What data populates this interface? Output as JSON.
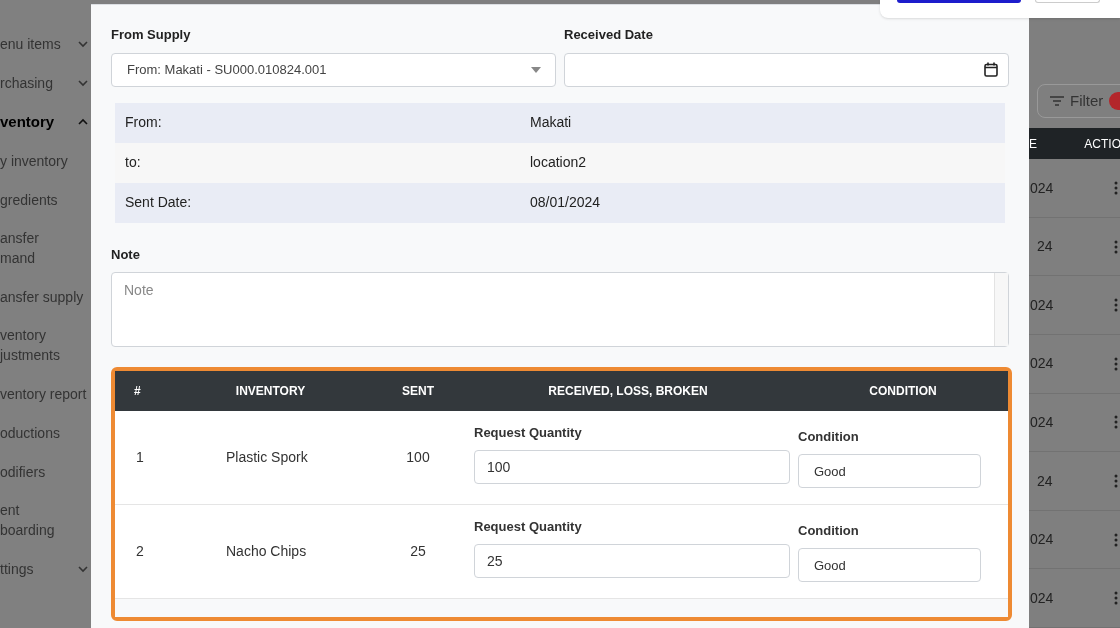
{
  "sidebar": {
    "items": [
      {
        "label": "enu items",
        "kind": "group",
        "expanded": false,
        "active": false
      },
      {
        "label": "rchasing",
        "kind": "group",
        "expanded": false,
        "active": false
      },
      {
        "label": "ventory",
        "kind": "group",
        "expanded": true,
        "active": true
      },
      {
        "label": "y inventory",
        "active": false
      },
      {
        "label": "gredients",
        "active": false
      },
      {
        "label": "ansfer\nmand",
        "active": false
      },
      {
        "label": "ansfer supply",
        "active": false
      },
      {
        "label": "ventory\njustments",
        "active": false
      },
      {
        "label": "ventory report",
        "active": false
      },
      {
        "label": "oductions",
        "active": false
      },
      {
        "label": "odifiers",
        "active": false
      },
      {
        "label": "ent\nboarding",
        "active": false
      },
      {
        "label": "ttings",
        "kind": "group",
        "expanded": false,
        "active": false
      }
    ]
  },
  "background_page": {
    "filter_button": "Filter",
    "header": [
      "E",
      "ACTIO"
    ],
    "rows": [
      "024",
      "24",
      "024",
      "024",
      "024",
      "24",
      "024",
      "024"
    ]
  },
  "modal": {
    "from_supply": {
      "label": "From Supply",
      "value": "From: Makati - SU000.010824.001"
    },
    "received_date": {
      "label": "Received Date"
    },
    "details": [
      {
        "label": "From:",
        "value": "Makati"
      },
      {
        "label": "to:",
        "value": "location2"
      },
      {
        "label": "Sent Date:",
        "value": "08/01/2024"
      }
    ],
    "note": {
      "label": "Note",
      "placeholder": "Note"
    },
    "table": {
      "columns": [
        "#",
        "INVENTORY",
        "SENT",
        "RECEIVED, LOSS, BROKEN",
        "CONDITION"
      ],
      "rows": [
        {
          "no": "1",
          "inventory": "Plastic Spork",
          "sent": "100",
          "quantity_label": "Request Quantity",
          "quantity": "100",
          "condition_label": "Condition",
          "condition": "Good"
        },
        {
          "no": "2",
          "inventory": "Nacho Chips",
          "sent": "25",
          "quantity_label": "Request Quantity",
          "quantity": "25",
          "condition_label": "Condition",
          "condition": "Good"
        }
      ]
    }
  }
}
